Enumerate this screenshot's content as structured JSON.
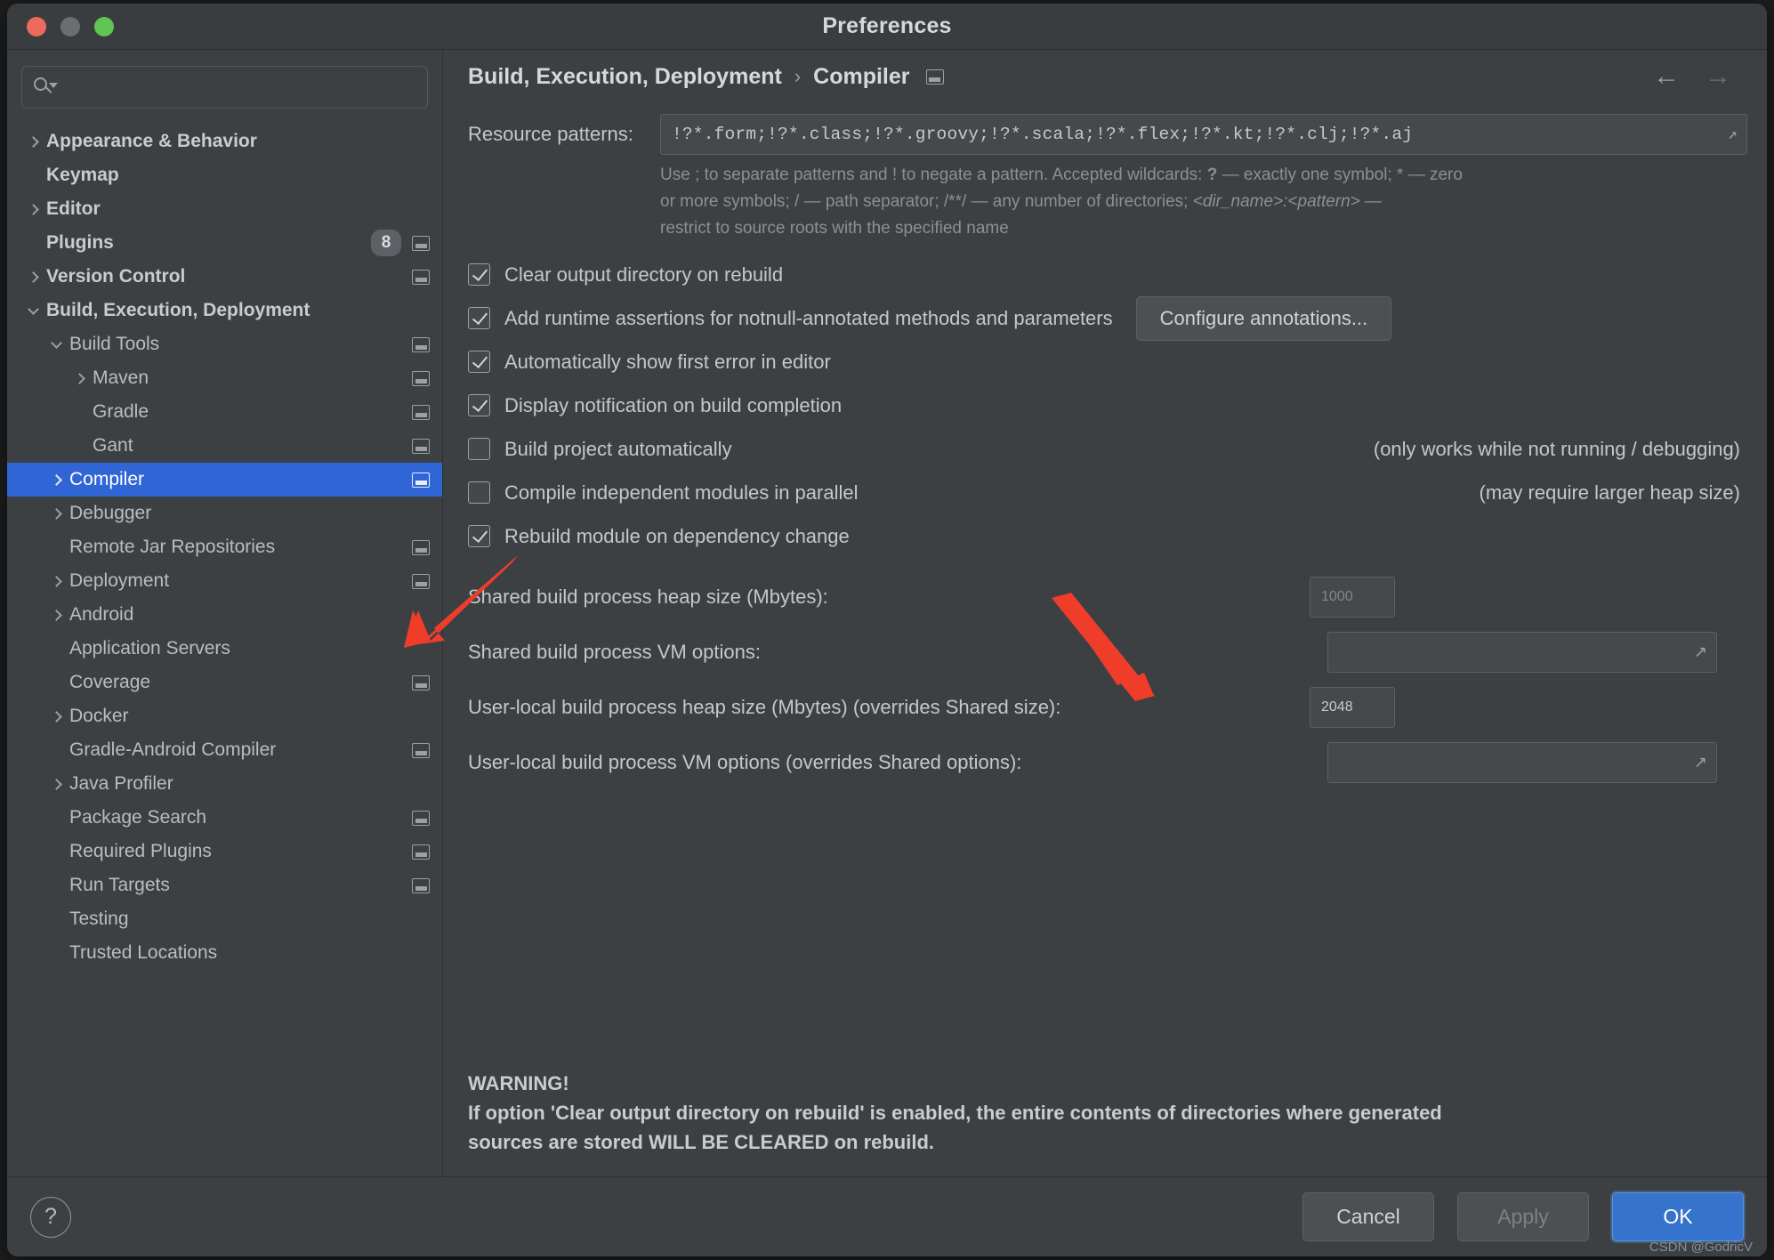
{
  "window": {
    "title": "Preferences",
    "traffic": [
      "close-red",
      "minimize-gray",
      "zoom-green"
    ]
  },
  "search": {
    "value": "",
    "placeholder": ""
  },
  "sidebar": {
    "items": [
      {
        "label": "Appearance & Behavior",
        "arrow": "right",
        "bold": true,
        "indent": 0,
        "badge": null,
        "mini": false,
        "selected": false
      },
      {
        "label": "Keymap",
        "arrow": "none",
        "bold": true,
        "indent": 0,
        "badge": null,
        "mini": false,
        "selected": false
      },
      {
        "label": "Editor",
        "arrow": "right",
        "bold": true,
        "indent": 0,
        "badge": null,
        "mini": false,
        "selected": false
      },
      {
        "label": "Plugins",
        "arrow": "none",
        "bold": true,
        "indent": 0,
        "badge": "8",
        "mini": true,
        "selected": false
      },
      {
        "label": "Version Control",
        "arrow": "right",
        "bold": true,
        "indent": 0,
        "badge": null,
        "mini": true,
        "selected": false
      },
      {
        "label": "Build, Execution, Deployment",
        "arrow": "down",
        "bold": true,
        "indent": 0,
        "badge": null,
        "mini": false,
        "selected": false
      },
      {
        "label": "Build Tools",
        "arrow": "down",
        "bold": false,
        "indent": 1,
        "badge": null,
        "mini": true,
        "selected": false
      },
      {
        "label": "Maven",
        "arrow": "right",
        "bold": false,
        "indent": 2,
        "badge": null,
        "mini": true,
        "selected": false
      },
      {
        "label": "Gradle",
        "arrow": "none",
        "bold": false,
        "indent": 2,
        "badge": null,
        "mini": true,
        "selected": false
      },
      {
        "label": "Gant",
        "arrow": "none",
        "bold": false,
        "indent": 2,
        "badge": null,
        "mini": true,
        "selected": false
      },
      {
        "label": "Compiler",
        "arrow": "right",
        "bold": false,
        "indent": 1,
        "badge": null,
        "mini": true,
        "selected": true
      },
      {
        "label": "Debugger",
        "arrow": "right",
        "bold": false,
        "indent": 1,
        "badge": null,
        "mini": false,
        "selected": false
      },
      {
        "label": "Remote Jar Repositories",
        "arrow": "none",
        "bold": false,
        "indent": 1,
        "badge": null,
        "mini": true,
        "selected": false
      },
      {
        "label": "Deployment",
        "arrow": "right",
        "bold": false,
        "indent": 1,
        "badge": null,
        "mini": true,
        "selected": false
      },
      {
        "label": "Android",
        "arrow": "right",
        "bold": false,
        "indent": 1,
        "badge": null,
        "mini": false,
        "selected": false
      },
      {
        "label": "Application Servers",
        "arrow": "none",
        "bold": false,
        "indent": 1,
        "badge": null,
        "mini": false,
        "selected": false
      },
      {
        "label": "Coverage",
        "arrow": "none",
        "bold": false,
        "indent": 1,
        "badge": null,
        "mini": true,
        "selected": false
      },
      {
        "label": "Docker",
        "arrow": "right",
        "bold": false,
        "indent": 1,
        "badge": null,
        "mini": false,
        "selected": false
      },
      {
        "label": "Gradle-Android Compiler",
        "arrow": "none",
        "bold": false,
        "indent": 1,
        "badge": null,
        "mini": true,
        "selected": false
      },
      {
        "label": "Java Profiler",
        "arrow": "right",
        "bold": false,
        "indent": 1,
        "badge": null,
        "mini": false,
        "selected": false
      },
      {
        "label": "Package Search",
        "arrow": "none",
        "bold": false,
        "indent": 1,
        "badge": null,
        "mini": true,
        "selected": false
      },
      {
        "label": "Required Plugins",
        "arrow": "none",
        "bold": false,
        "indent": 1,
        "badge": null,
        "mini": true,
        "selected": false
      },
      {
        "label": "Run Targets",
        "arrow": "none",
        "bold": false,
        "indent": 1,
        "badge": null,
        "mini": true,
        "selected": false
      },
      {
        "label": "Testing",
        "arrow": "none",
        "bold": false,
        "indent": 1,
        "badge": null,
        "mini": false,
        "selected": false
      },
      {
        "label": "Trusted Locations",
        "arrow": "none",
        "bold": false,
        "indent": 1,
        "badge": null,
        "mini": false,
        "selected": false
      }
    ]
  },
  "breadcrumb": {
    "parent": "Build, Execution, Deployment",
    "separator": "›",
    "current": "Compiler",
    "back_arrow": "←",
    "forward_arrow": "→"
  },
  "main": {
    "resource_patterns_label": "Resource patterns:",
    "resource_patterns_value": "!?*.form;!?*.class;!?*.groovy;!?*.scala;!?*.flex;!?*.kt;!?*.clj;!?*.aj",
    "hint_line1_a": "Use ; to separate patterns and ! to negate a pattern. Accepted wildcards: ",
    "hint_line1_b": "?",
    "hint_line1_c": " — exactly one symbol; * — zero",
    "hint_line2_a": "or more symbols; / — path separator; /**/ — any number of directories; ",
    "hint_line2_b": "<dir_name>:<pattern>",
    "hint_line2_c": " —",
    "hint_line3": "restrict to source roots with the specified name",
    "checkboxes": [
      {
        "label": "Clear output directory on rebuild",
        "checked": true,
        "note": ""
      },
      {
        "label": "Add runtime assertions for notnull-annotated methods and parameters",
        "checked": true,
        "note": ""
      },
      {
        "label": "Automatically show first error in editor",
        "checked": true,
        "note": ""
      },
      {
        "label": "Display notification on build completion",
        "checked": true,
        "note": ""
      },
      {
        "label": "Build project automatically",
        "checked": false,
        "note": "(only works while not running / debugging)"
      },
      {
        "label": "Compile independent modules in parallel",
        "checked": false,
        "note": "(may require larger heap size)"
      },
      {
        "label": "Rebuild module on dependency change",
        "checked": true,
        "note": ""
      }
    ],
    "configure_annotations_button": "Configure annotations...",
    "fields": [
      {
        "label": "Shared build process heap size (Mbytes):",
        "value": "1000",
        "placeholder": true,
        "expand": false
      },
      {
        "label": "Shared build process VM options:",
        "value": "",
        "placeholder": false,
        "expand": true
      },
      {
        "label": "User-local build process heap size (Mbytes) (overrides Shared size):",
        "value": "2048",
        "placeholder": false,
        "expand": false
      },
      {
        "label": "User-local build process VM options (overrides Shared options):",
        "value": "",
        "placeholder": false,
        "expand": true
      }
    ],
    "warning_title": "WARNING!",
    "warning_line1": "If option 'Clear output directory on rebuild' is enabled, the entire contents of directories where generated",
    "warning_line2": "sources are stored WILL BE CLEARED on rebuild."
  },
  "footer": {
    "help_label": "?",
    "cancel_label": "Cancel",
    "apply_label": "Apply",
    "ok_label": "OK",
    "watermark": "CSDN @GodricV"
  },
  "colors": {
    "accent": "#2f65d4",
    "primary_button": "#3573cc",
    "annotation": "#ef3d2a",
    "window_bg": "#3c4043"
  }
}
